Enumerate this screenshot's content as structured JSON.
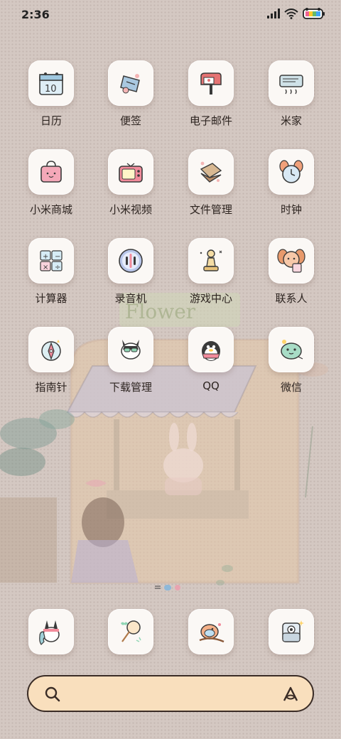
{
  "status_bar": {
    "time": "2:36"
  },
  "wallpaper": {
    "sign_text": "Flower"
  },
  "apps": [
    {
      "label": "日历",
      "icon": "calendar-icon",
      "badge_text": "10"
    },
    {
      "label": "便签",
      "icon": "notes-icon"
    },
    {
      "label": "电子邮件",
      "icon": "mailbox-icon"
    },
    {
      "label": "米家",
      "icon": "mijia-icon"
    },
    {
      "label": "小米商城",
      "icon": "shopping-bag-icon"
    },
    {
      "label": "小米视频",
      "icon": "tv-icon"
    },
    {
      "label": "文件管理",
      "icon": "folder-icon"
    },
    {
      "label": "时钟",
      "icon": "alarm-clock-icon"
    },
    {
      "label": "计算器",
      "icon": "calculator-icon"
    },
    {
      "label": "录音机",
      "icon": "recorder-icon"
    },
    {
      "label": "游戏中心",
      "icon": "chess-pawn-icon"
    },
    {
      "label": "联系人",
      "icon": "contacts-icon"
    },
    {
      "label": "指南针",
      "icon": "compass-icon"
    },
    {
      "label": "下载管理",
      "icon": "download-icon"
    },
    {
      "label": "QQ",
      "icon": "qq-penguin-icon"
    },
    {
      "label": "微信",
      "icon": "wechat-icon"
    }
  ],
  "dock": [
    {
      "icon": "phone-icon"
    },
    {
      "icon": "butterfly-net-icon"
    },
    {
      "icon": "message-bird-icon"
    },
    {
      "icon": "camera-icon"
    }
  ],
  "colors": {
    "background": "#d4c8c2",
    "search_bar": "#f9dfbd",
    "search_border": "#3a2c26"
  }
}
